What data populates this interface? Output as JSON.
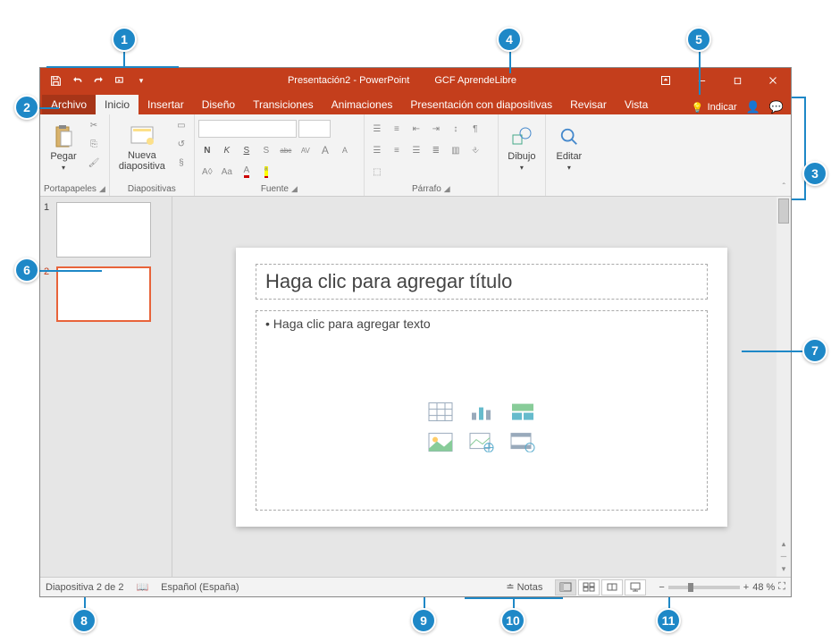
{
  "title": {
    "doc": "Presentación2",
    "app": "PowerPoint",
    "user": "GCF AprendeLibre"
  },
  "tabs": {
    "file": "Archivo",
    "items": [
      "Inicio",
      "Insertar",
      "Diseño",
      "Transiciones",
      "Animaciones",
      "Presentación con diapositivas",
      "Revisar",
      "Vista"
    ],
    "active": 0,
    "tellme": "Indicar"
  },
  "ribbon": {
    "clipboard": {
      "paste": "Pegar",
      "label": "Portapapeles"
    },
    "slides": {
      "new": "Nueva diapositiva",
      "label": "Diapositivas"
    },
    "font": {
      "label": "Fuente",
      "bold": "N",
      "italic": "K",
      "underline": "S",
      "shadow": "S",
      "strike": "abc",
      "spacing": "AV",
      "clear": "Aa",
      "grow": "A",
      "shrink": "A"
    },
    "paragraph": {
      "label": "Párrafo"
    },
    "drawing": {
      "label": "Dibujo"
    },
    "editing": {
      "label": "Editar"
    }
  },
  "thumbnails": [
    {
      "n": "1"
    },
    {
      "n": "2"
    }
  ],
  "slide": {
    "title_ph": "Haga clic para agregar título",
    "body_ph": "• Haga clic para agregar texto"
  },
  "status": {
    "slide_info": "Diapositiva 2 de 2",
    "lang": "Español (España)",
    "notes": "Notas",
    "zoom_pct": "48 %"
  },
  "annotations": [
    "1",
    "2",
    "3",
    "4",
    "5",
    "6",
    "7",
    "8",
    "9",
    "10",
    "11"
  ]
}
